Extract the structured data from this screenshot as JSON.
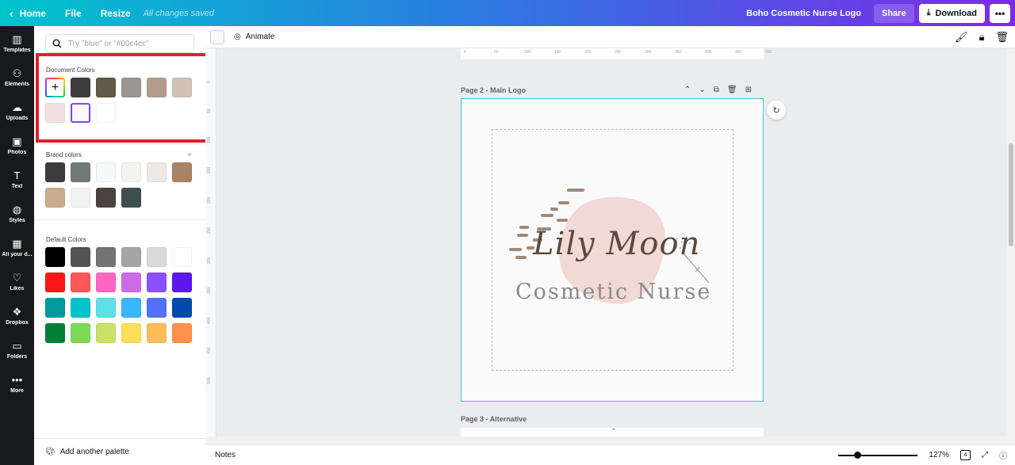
{
  "topbar": {
    "home": "Home",
    "file": "File",
    "resize": "Resize",
    "saved": "All changes saved",
    "doc_title": "Boho Cosmetic Nurse Logo",
    "share": "Share",
    "download": "Download"
  },
  "rail": {
    "items": [
      {
        "label": "Templates",
        "icon": "▥"
      },
      {
        "label": "Elements",
        "icon": "⚇"
      },
      {
        "label": "Uploads",
        "icon": "☁"
      },
      {
        "label": "Photos",
        "icon": "▣"
      },
      {
        "label": "Text",
        "icon": "T"
      },
      {
        "label": "Styles",
        "icon": "◍"
      },
      {
        "label": "All your d...",
        "icon": "▦"
      },
      {
        "label": "Likes",
        "icon": "♡"
      },
      {
        "label": "Dropbox",
        "icon": "❖"
      },
      {
        "label": "Folders",
        "icon": "▭"
      },
      {
        "label": "More",
        "icon": "•••"
      }
    ]
  },
  "panel": {
    "search_placeholder": "Try \"blue\" or \"#00c4cc\"",
    "document_colors_title": "Document Colors",
    "document_colors": [
      "#3d3d3d",
      "#5e5a45",
      "#9b9595",
      "#b39d8a",
      "#d1c0b6",
      "#f2e1df",
      "#f9f9f9",
      "#ffffff"
    ],
    "brand_colors_title": "Brand colors",
    "brand_colors": [
      "#3d3d3d",
      "#6f7b74",
      "#f7f8fa",
      "#f5f3f0",
      "#ede8e3",
      "#a78467",
      "#c8ae8e",
      "#f1f1f1",
      "#4a4440",
      "#3e4f4d"
    ],
    "default_colors_title": "Default Colors",
    "default_colors": [
      "#000000",
      "#545454",
      "#737373",
      "#a6a6a6",
      "#d9d9d9",
      "#ffffff",
      "#ff1616",
      "#ff5757",
      "#ff66c4",
      "#cb6ce6",
      "#8c52ff",
      "#5e17eb",
      "#03989e",
      "#00c2cb",
      "#5ce1e6",
      "#38b6ff",
      "#5271ff",
      "#004aad",
      "#008037",
      "#7ed957",
      "#c9e265",
      "#ffde59",
      "#ffbd59",
      "#ff914d"
    ],
    "footer": "Add another palette"
  },
  "toolbar": {
    "animate": "Animate"
  },
  "canvas": {
    "ruler_h": [
      "0",
      "50",
      "100",
      "150",
      "200",
      "250",
      "300",
      "350",
      "400",
      "450",
      "500"
    ],
    "ruler_v": [
      "0",
      "50",
      "100",
      "150",
      "200",
      "250",
      "300",
      "350",
      "400",
      "450",
      "500"
    ],
    "page2_label": "Page 2 - Main Logo",
    "page3_label": "Page 3 - Alternative",
    "logo_script": "Lily Moon",
    "logo_sub": "Cosmetic Nurse"
  },
  "bottombar": {
    "notes": "Notes",
    "zoom": "127%",
    "page_count": "4"
  }
}
